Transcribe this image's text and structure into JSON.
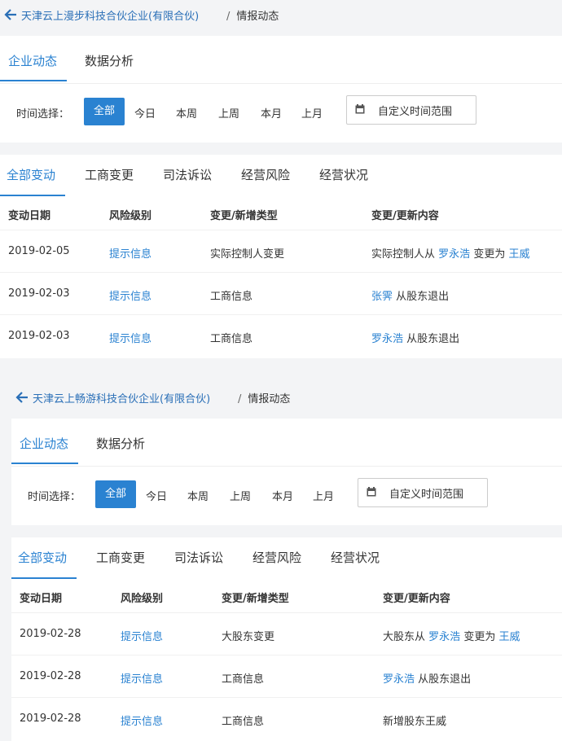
{
  "panels": [
    {
      "company": "天津云上漫步科技合伙企业(有限合伙)",
      "breadcrumb_sep": "/",
      "section": "情报动态",
      "tabs": [
        "企业动态",
        "数据分析"
      ],
      "filter_label": "时间选择：",
      "time_options": [
        "全部",
        "今日",
        "本周",
        "上周",
        "本月",
        "上月"
      ],
      "custom_range": "自定义时间范围",
      "change_tabs": [
        "全部变动",
        "工商变更",
        "司法诉讼",
        "经营风险",
        "经营状况"
      ],
      "columns": [
        "变动日期",
        "风险级别",
        "变更/新增类型",
        "变更/更新内容"
      ],
      "rows": [
        {
          "date": "2019-02-05",
          "risk": "提示信息",
          "type": "实际控制人变更",
          "c1": "实际控制人从",
          "c2": "罗永浩",
          "c3": "变更为",
          "c4": "王威"
        },
        {
          "date": "2019-02-03",
          "risk": "提示信息",
          "type": "工商信息",
          "c1": "",
          "c2": "张霁",
          "c3": "从股东退出",
          "c4": ""
        },
        {
          "date": "2019-02-03",
          "risk": "提示信息",
          "type": "工商信息",
          "c1": "",
          "c2": "罗永浩",
          "c3": "从股东退出",
          "c4": ""
        }
      ]
    },
    {
      "company": "天津云上畅游科技合伙企业(有限合伙)",
      "breadcrumb_sep": "/",
      "section": "情报动态",
      "tabs": [
        "企业动态",
        "数据分析"
      ],
      "filter_label": "时间选择：",
      "time_options": [
        "全部",
        "今日",
        "本周",
        "上周",
        "本月",
        "上月"
      ],
      "custom_range": "自定义时间范围",
      "change_tabs": [
        "全部变动",
        "工商变更",
        "司法诉讼",
        "经营风险",
        "经营状况"
      ],
      "columns": [
        "变动日期",
        "风险级别",
        "变更/新增类型",
        "变更/更新内容"
      ],
      "rows": [
        {
          "date": "2019-02-28",
          "risk": "提示信息",
          "type": "大股东变更",
          "c1": "大股东从",
          "c2": "罗永浩",
          "c3": "变更为",
          "c4": "王威"
        },
        {
          "date": "2019-02-28",
          "risk": "提示信息",
          "type": "工商信息",
          "c1": "",
          "c2": "罗永浩",
          "c3": "从股东退出",
          "c4": ""
        },
        {
          "date": "2019-02-28",
          "risk": "提示信息",
          "type": "工商信息",
          "c1": "新增股东王威",
          "c2": "",
          "c3": "",
          "c4": ""
        }
      ]
    }
  ],
  "colors": {
    "accent": "#2a82d1",
    "link": "#2a6fb7"
  }
}
